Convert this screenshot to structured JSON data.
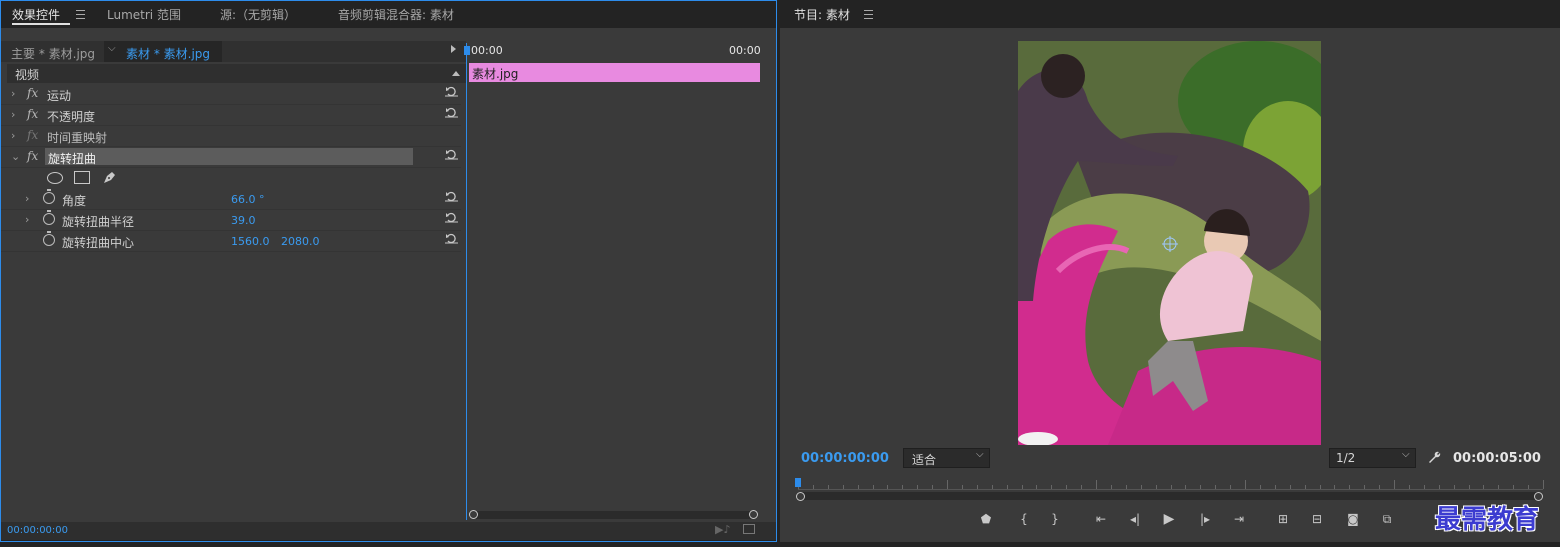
{
  "left_panel": {
    "tabs": [
      "效果控件",
      "Lumetri 范围",
      "源:（无剪辑）",
      "音频剪辑混合器: 素材"
    ],
    "clip_selector": {
      "master": "主要 * 素材.jpg",
      "sequence_clip": "素材 * 素材.jpg"
    },
    "section_video": "视频",
    "effects": [
      {
        "label": "运动"
      },
      {
        "label": "不透明度"
      },
      {
        "label": "时间重映射"
      },
      {
        "label": "旋转扭曲"
      }
    ],
    "params": [
      {
        "label": "角度",
        "value": "66.0 °"
      },
      {
        "label": "旋转扭曲半径",
        "value": "39.0"
      },
      {
        "label": "旋转扭曲中心",
        "value": "1560.0",
        "value2": "2080.0"
      }
    ],
    "timeline": {
      "start": "00:00",
      "end": "00:00",
      "clip": "素材.jpg",
      "clip_color": "#e88ae0"
    },
    "timecode": "00:00:00:00"
  },
  "right_panel": {
    "title": "节目: 素材",
    "timecode_current": "00:00:00:00",
    "fit": "适合",
    "resolution": "1/2",
    "timecode_duration": "00:00:05:00",
    "accent": "#2d8ceb"
  },
  "watermark": "最需教育"
}
